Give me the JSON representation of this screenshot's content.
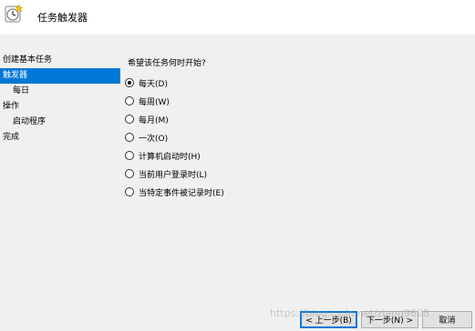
{
  "header": {
    "title": "任务触发器"
  },
  "nav": {
    "items": [
      {
        "label": "创建基本任务"
      },
      {
        "label": "触发器"
      },
      {
        "label": "每日"
      },
      {
        "label": "操作"
      },
      {
        "label": "启动程序"
      },
      {
        "label": "完成"
      }
    ]
  },
  "main": {
    "question": "希望该任务何时开始?",
    "options": [
      {
        "label": "每天(D)",
        "checked": true
      },
      {
        "label": "每周(W)"
      },
      {
        "label": "每月(M)"
      },
      {
        "label": "一次(O)"
      },
      {
        "label": "计算机启动时(H)"
      },
      {
        "label": "当前用户登录时(L)"
      },
      {
        "label": "当特定事件被记录时(E)"
      }
    ]
  },
  "buttons": {
    "back": "< 上一步(B)",
    "next": "下一步(N) >",
    "cancel": "取消"
  },
  "watermark": "https://blog.csdn.net/zlang9628",
  "colors": {
    "selection": "#0078d7",
    "panel": "#f0f0f0"
  },
  "icons": {
    "header": "task-scheduler-clock-icon"
  }
}
